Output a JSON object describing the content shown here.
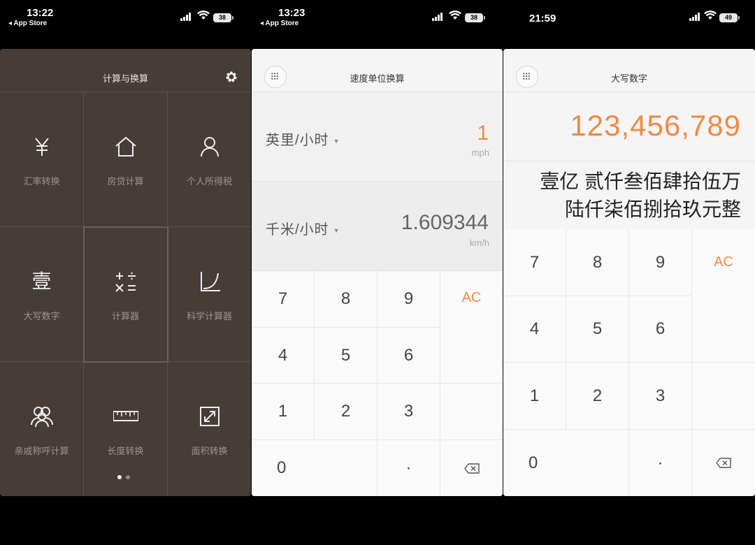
{
  "screens": [
    {
      "status": {
        "time": "13:22",
        "back_label": "◂ App Store",
        "battery": "38"
      },
      "title": "计算与换算",
      "tiles": [
        {
          "label": "汇率转换",
          "icon": "yuan-icon"
        },
        {
          "label": "房贷计算",
          "icon": "house-icon"
        },
        {
          "label": "个人所得税",
          "icon": "person-icon"
        },
        {
          "label": "大写数字",
          "icon": "capital-number-icon",
          "glyph": "壹"
        },
        {
          "label": "计算器",
          "icon": "calculator-icon"
        },
        {
          "label": "科学计算器",
          "icon": "scientific-calculator-icon"
        },
        {
          "label": "亲戚称呼计算",
          "icon": "relatives-icon"
        },
        {
          "label": "长度转换",
          "icon": "ruler-icon"
        },
        {
          "label": "面积转换",
          "icon": "area-icon"
        }
      ],
      "selected_tile": "计算器",
      "page_indicator": {
        "pages": 2,
        "current": 1
      }
    },
    {
      "status": {
        "time": "13:23",
        "back_label": "◂ App Store",
        "battery": "38"
      },
      "title": "速度单位换算",
      "from": {
        "unit": "英里/小时",
        "value": "1",
        "abbr": "mph"
      },
      "to": {
        "unit": "千米/小时",
        "value": "1.609344",
        "abbr": "km/h"
      }
    },
    {
      "status": {
        "time": "21:59",
        "battery": "49"
      },
      "title": "大写数字",
      "number": "123,456,789",
      "uppercase_line1": "壹亿 贰仟叁佰肆拾伍万",
      "uppercase_line2": "陆仟柒佰捌拾玖元整"
    }
  ],
  "keypad": {
    "row1": [
      "7",
      "8",
      "9"
    ],
    "row2": [
      "4",
      "5",
      "6"
    ],
    "row3": [
      "1",
      "2",
      "3"
    ],
    "zero": "0",
    "dot": "·",
    "clear": "AC",
    "backspace_icon": "backspace-icon"
  },
  "colors": {
    "dark_bg": "#463d37",
    "accent": "#f08a44",
    "light_bg": "#f5f5f5",
    "muted_label": "#9d948c"
  }
}
